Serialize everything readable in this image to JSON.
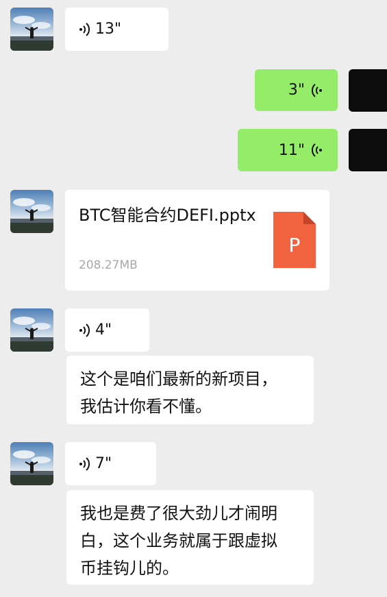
{
  "messages": {
    "m1": {
      "duration": "13\""
    },
    "m2": {
      "duration": "3\""
    },
    "m3": {
      "duration": "11\""
    },
    "file": {
      "name": "BTC智能合约DEFI.pptx",
      "size": "208.27MB",
      "icon_letter": "P",
      "icon_color": "#f1633f"
    },
    "m5": {
      "duration": "4\""
    },
    "m6": {
      "text": "这个是咱们最新的新项目，\n我估计你看不懂。"
    },
    "m7": {
      "duration": "7\""
    },
    "m8": {
      "text": "我也是费了很大劲儿才闹明\n白，这个业务就属于跟虚拟\n币挂钩儿的。"
    }
  },
  "colors": {
    "background": "#ededed",
    "incoming_bubble": "#ffffff",
    "outgoing_bubble": "#95ec69"
  }
}
